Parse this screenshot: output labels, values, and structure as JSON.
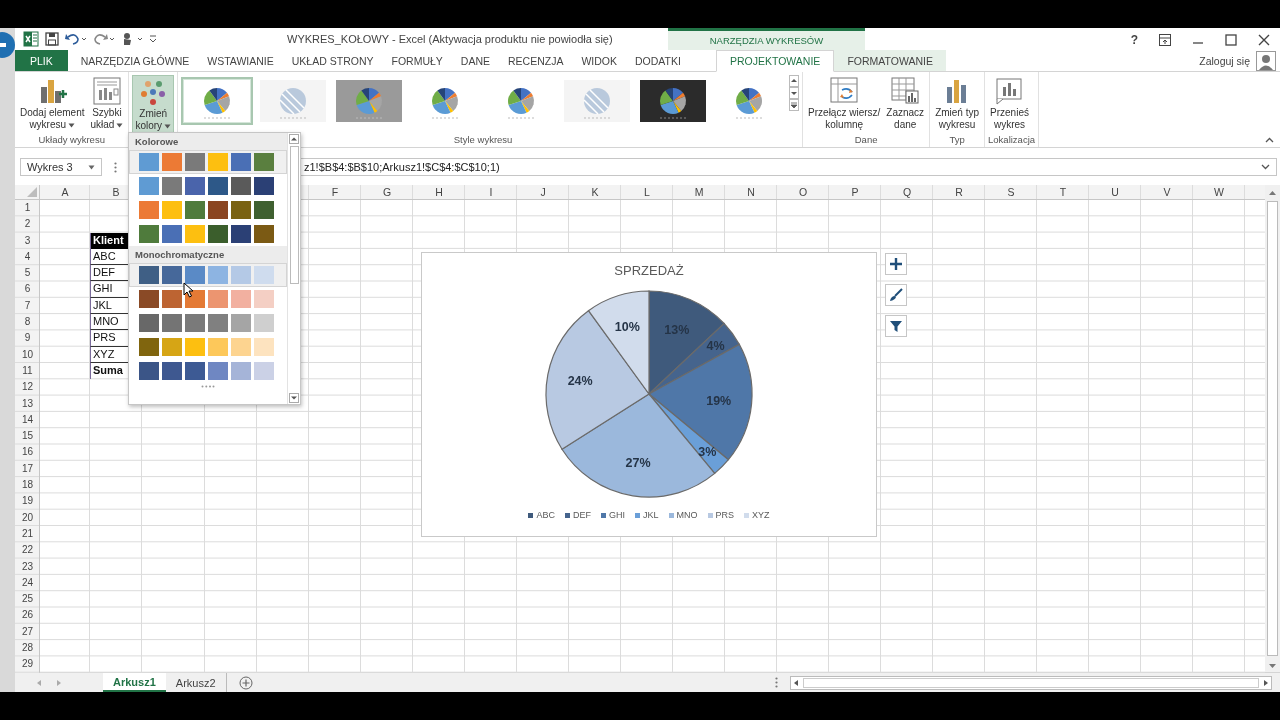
{
  "title_bar": {
    "title": "WYKRES_KOŁOWY - Excel (Aktywacja produktu nie powiodła się)",
    "contextual": "NARZĘDZIA WYKRESÓW",
    "help": "?"
  },
  "tabs": [
    {
      "label": "PLIK",
      "kind": "file",
      "selected": false
    },
    {
      "label": "NARZĘDZIA GŁÓWNE",
      "kind": "main",
      "selected": false
    },
    {
      "label": "WSTAWIANIE",
      "kind": "main",
      "selected": false
    },
    {
      "label": "UKŁAD STRONY",
      "kind": "main",
      "selected": false
    },
    {
      "label": "FORMUŁY",
      "kind": "main",
      "selected": false
    },
    {
      "label": "DANE",
      "kind": "main",
      "selected": false
    },
    {
      "label": "RECENZJA",
      "kind": "main",
      "selected": false
    },
    {
      "label": "WIDOK",
      "kind": "main",
      "selected": false
    },
    {
      "label": "DODATKI",
      "kind": "main",
      "selected": false
    },
    {
      "label": "PROJEKTOWANIE",
      "kind": "context",
      "selected": true
    },
    {
      "label": "FORMATOWANIE",
      "kind": "context",
      "selected": false
    }
  ],
  "account": "Zaloguj się",
  "ribbon": {
    "groups": [
      {
        "label": "Układy wykresu",
        "buttons": [
          {
            "kind": "add",
            "lines": [
              "Dodaj element",
              "wykresu"
            ],
            "menu": true,
            "selected": false
          },
          {
            "kind": "layout",
            "lines": [
              "Szybki",
              "układ"
            ],
            "menu": true,
            "selected": false
          }
        ]
      },
      {
        "buttons": [
          {
            "kind": "colors",
            "lines": [
              "Zmień",
              "kolory"
            ],
            "menu": true,
            "selected": true
          }
        ]
      },
      {
        "label": "Style wykresu",
        "kind": "gallery",
        "thumbnails": [
          {
            "kind": "light",
            "selected": true
          },
          {
            "kind": "hatched",
            "selected": false
          },
          {
            "kind": "gray",
            "selected": false
          },
          {
            "kind": "light",
            "selected": false
          },
          {
            "kind": "light",
            "selected": false
          },
          {
            "kind": "hatched",
            "selected": false
          },
          {
            "kind": "dark",
            "selected": false
          },
          {
            "kind": "light",
            "selected": false
          }
        ]
      },
      {
        "label": "Dane",
        "buttons": [
          {
            "kind": "switch",
            "lines": [
              "Przełącz wiersz/",
              "kolumnę"
            ],
            "menu": false,
            "selected": false
          },
          {
            "kind": "select",
            "lines": [
              "Zaznacz",
              "dane"
            ],
            "menu": false,
            "selected": false
          }
        ]
      },
      {
        "label": "Typ",
        "buttons": [
          {
            "kind": "charttype",
            "lines": [
              "Zmień typ",
              "wykresu"
            ],
            "menu": false,
            "selected": false
          }
        ]
      },
      {
        "label": "Lokalizacja",
        "buttons": [
          {
            "kind": "move",
            "lines": [
              "Przenieś",
              "wykres"
            ],
            "menu": false,
            "selected": false
          }
        ]
      }
    ]
  },
  "formula_bar": {
    "name_box": "Wykres 3",
    "formula": "z1!$B$4:$B$10;Arkusz1!$C$4:$C$10;1)"
  },
  "sheet": {
    "columns": [
      "A",
      "B",
      "F",
      "G",
      "H",
      "I",
      "J",
      "K",
      "L",
      "M",
      "N",
      "O",
      "P",
      "Q",
      "R",
      "S",
      "T",
      "U",
      "V",
      "W"
    ],
    "rows": [
      {
        "number": "1"
      },
      {
        "number": "2"
      },
      {
        "number": "3",
        "b": "Klient",
        "kind": "header"
      },
      {
        "number": "4",
        "b": "ABC",
        "kind": "name"
      },
      {
        "number": "5",
        "b": "DEF",
        "kind": "name"
      },
      {
        "number": "6",
        "b": "GHI",
        "kind": "name"
      },
      {
        "number": "7",
        "b": "JKL",
        "kind": "name"
      },
      {
        "number": "8",
        "b": "MNO",
        "kind": "name"
      },
      {
        "number": "9",
        "b": "PRS",
        "kind": "name"
      },
      {
        "number": "10",
        "b": "XYZ",
        "kind": "name"
      },
      {
        "number": "11",
        "b": "Suma",
        "kind": "total"
      },
      {
        "number": "12"
      },
      {
        "number": "13"
      },
      {
        "number": "14"
      },
      {
        "number": "15"
      },
      {
        "number": "16"
      },
      {
        "number": "17"
      },
      {
        "number": "18"
      },
      {
        "number": "19"
      },
      {
        "number": "20"
      },
      {
        "number": "21"
      },
      {
        "number": "22"
      },
      {
        "number": "23"
      },
      {
        "number": "24"
      },
      {
        "number": "25"
      },
      {
        "number": "26"
      },
      {
        "number": "27"
      },
      {
        "number": "28"
      },
      {
        "number": "29"
      }
    ]
  },
  "chart": {
    "chart_data": {
      "type": "pie",
      "title": "SPRZEDAŻ",
      "categories": [
        "ABC",
        "DEF",
        "GHI",
        "JKL",
        "MNO",
        "PRS",
        "XYZ"
      ],
      "values": [
        13,
        4,
        19,
        3,
        27,
        24,
        10
      ],
      "value_labels": [
        "13%",
        "4%",
        "19%",
        "3%",
        "27%",
        "24%",
        "10%"
      ],
      "legend": "bottom"
    },
    "slices": [
      {
        "color": "#3f5a7c"
      },
      {
        "color": "#45648d"
      },
      {
        "color": "#4f77a8"
      },
      {
        "color": "#6a9fd8"
      },
      {
        "color": "#9bb8dc"
      },
      {
        "color": "#b8c9e2"
      },
      {
        "color": "#d1dcec"
      }
    ]
  },
  "color_menu": {
    "sections": [
      {
        "heading": "Kolorowe",
        "rows": [
          {
            "highlighted": true,
            "swatches": [
              {
                "color": "#5f9bd3"
              },
              {
                "color": "#ec7a35"
              },
              {
                "color": "#7a7a7a"
              },
              {
                "color": "#fdbf10"
              },
              {
                "color": "#4a6fb5"
              },
              {
                "color": "#5a7f3f"
              }
            ]
          },
          {
            "highlighted": false,
            "swatches": [
              {
                "color": "#5f9bd3"
              },
              {
                "color": "#7a7a7a"
              },
              {
                "color": "#4a64ab"
              },
              {
                "color": "#2d5888"
              },
              {
                "color": "#5a5a5a"
              },
              {
                "color": "#2b4075"
              }
            ]
          },
          {
            "highlighted": false,
            "swatches": [
              {
                "color": "#ec7a35"
              },
              {
                "color": "#fdbf10"
              },
              {
                "color": "#4f7b3c"
              },
              {
                "color": "#8a4521"
              },
              {
                "color": "#7a6212"
              },
              {
                "color": "#3f6030"
              }
            ]
          },
          {
            "highlighted": false,
            "swatches": [
              {
                "color": "#4f7b3c"
              },
              {
                "color": "#4a6fb5"
              },
              {
                "color": "#fdbf10"
              },
              {
                "color": "#3b5e2c"
              },
              {
                "color": "#2b4075"
              },
              {
                "color": "#7b5a14"
              }
            ]
          }
        ]
      },
      {
        "heading": "Monochromatyczne",
        "rows": [
          {
            "highlighted": true,
            "swatches": [
              {
                "color": "#3f5f85"
              },
              {
                "color": "#46689a"
              },
              {
                "color": "#5a8ac6"
              },
              {
                "color": "#8db4e2"
              },
              {
                "color": "#b4c9e6"
              },
              {
                "color": "#cfdcee"
              }
            ]
          },
          {
            "highlighted": false,
            "swatches": [
              {
                "color": "#8a4a26"
              },
              {
                "color": "#bd6432"
              },
              {
                "color": "#e47a35"
              },
              {
                "color": "#ec9570"
              },
              {
                "color": "#f2b0a0"
              },
              {
                "color": "#f4cfc4"
              }
            ]
          },
          {
            "highlighted": false,
            "swatches": [
              {
                "color": "#686868"
              },
              {
                "color": "#747474"
              },
              {
                "color": "#7a7a7a"
              },
              {
                "color": "#808080"
              },
              {
                "color": "#a5a5a5"
              },
              {
                "color": "#cfcfcf"
              }
            ]
          },
          {
            "highlighted": false,
            "swatches": [
              {
                "color": "#80650e"
              },
              {
                "color": "#d6a515"
              },
              {
                "color": "#fdbf10"
              },
              {
                "color": "#fdc85a"
              },
              {
                "color": "#fdd490"
              },
              {
                "color": "#fde3bf"
              }
            ]
          },
          {
            "highlighted": false,
            "swatches": [
              {
                "color": "#3b5587"
              },
              {
                "color": "#3e5890"
              },
              {
                "color": "#3d5a94"
              },
              {
                "color": "#6f87c2"
              },
              {
                "color": "#a5b4d8"
              },
              {
                "color": "#cbd1e6"
              }
            ]
          }
        ]
      }
    ]
  },
  "sheet_tabs": [
    {
      "label": "Arkusz1",
      "selected": true
    },
    {
      "label": "Arkusz2",
      "selected": false
    }
  ]
}
